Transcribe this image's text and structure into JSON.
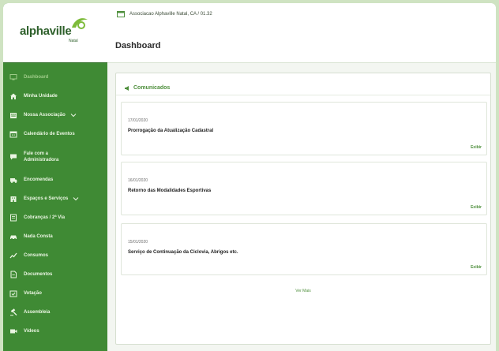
{
  "brand": {
    "logo_text": "alphaville",
    "logo_sub": "Natal"
  },
  "sidebar": {
    "items": [
      {
        "label": "Dashboard",
        "icon": "monitor-icon"
      },
      {
        "label": "Minha Unidade",
        "icon": "home-icon"
      },
      {
        "label": "Nossa Associação",
        "icon": "building-icon"
      },
      {
        "label": "Calendário de Eventos",
        "icon": "calendar-icon"
      },
      {
        "label": "Fale com a Administradora",
        "icon": "chat-icon"
      },
      {
        "label": "Encomendas",
        "icon": "package-icon"
      },
      {
        "label": "Espaços e Serviços",
        "icon": "building-icon"
      },
      {
        "label": "Cobranças / 2ª Via",
        "icon": "invoice-icon"
      },
      {
        "label": "Nada Consta",
        "icon": "car-icon"
      },
      {
        "label": "Consumos",
        "icon": "chart-icon"
      },
      {
        "label": "Documentos",
        "icon": "document-icon"
      },
      {
        "label": "Votação",
        "icon": "vote-icon"
      },
      {
        "label": "Assembleia",
        "icon": "gavel-icon"
      },
      {
        "label": "Vídeos",
        "icon": "video-icon"
      }
    ]
  },
  "header": {
    "breadcrumb": "Associacao Alphaville Natal, CA / 01.32",
    "page_title": "Dashboard"
  },
  "communications": {
    "title": "Comunicados",
    "items": [
      {
        "date": "17/01/2020",
        "title": "Prorrogação da Atualização Cadastral",
        "link": "Exibir"
      },
      {
        "date": "16/01/2020",
        "title": "Retorno das Modalidades Esportivas",
        "link": "Exibir"
      },
      {
        "date": "15/01/2020",
        "title": "Serviço de Continuação da Ciclovia, Abrigos etc.",
        "link": "Exibir"
      }
    ],
    "see_more": "Ver Mais"
  },
  "colors": {
    "sidebar": "#3f8a34",
    "accent": "#4e8f3c",
    "background": "#f3f6f1"
  }
}
